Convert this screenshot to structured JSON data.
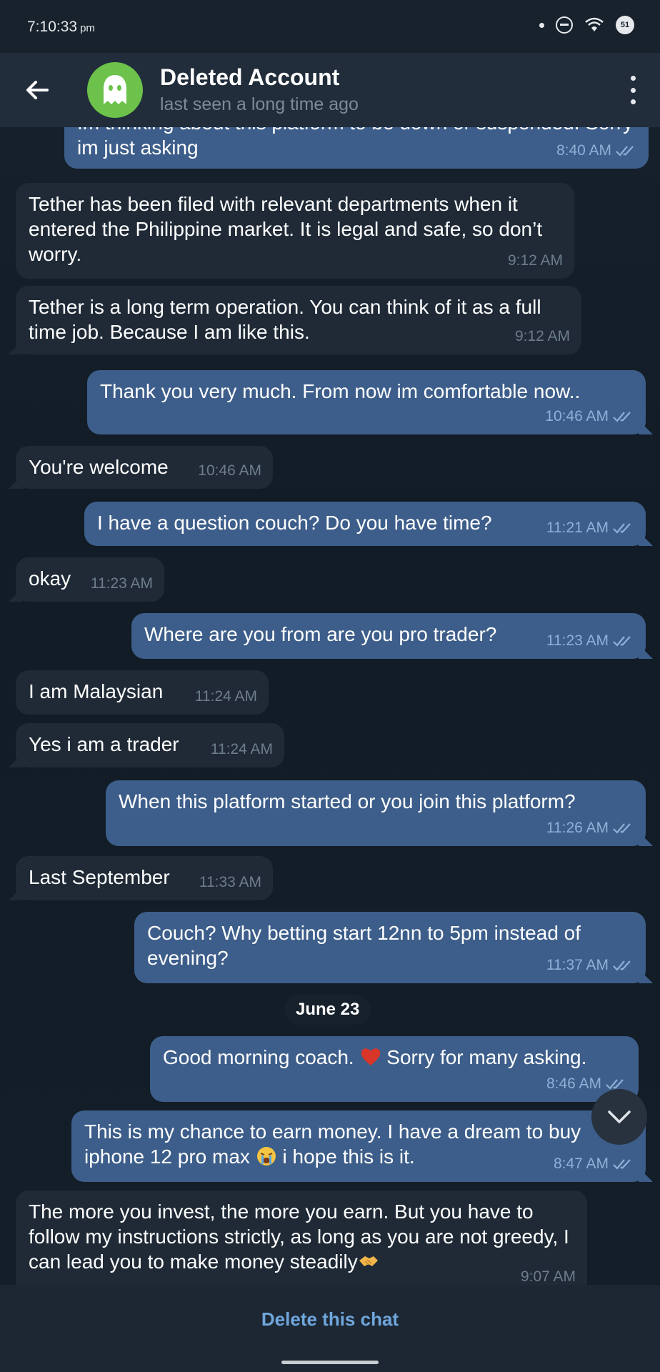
{
  "status_bar": {
    "time": "7:10:33",
    "ampm": "pm",
    "battery": "51"
  },
  "header": {
    "title": "Deleted Account",
    "subtitle": "last seen a long time ago"
  },
  "messages": [
    {
      "dir": "out",
      "text": "Im thinking about this platform to be down or suspended. Sorry im just asking",
      "time": "8:40 AM"
    },
    {
      "dir": "in",
      "text": "Tether has been filed with relevant departments when it entered the Philippine market. It is legal and safe, so don’t worry.",
      "time": "9:12 AM"
    },
    {
      "dir": "in",
      "text": "Tether is a long term operation. You can think of it as a full time job. Because I am like this.",
      "time": "9:12 AM"
    },
    {
      "dir": "out",
      "text": "Thank you very much. From now im comfortable now..",
      "time": "10:46 AM"
    },
    {
      "dir": "in",
      "text": "You're welcome",
      "time": "10:46 AM"
    },
    {
      "dir": "out",
      "text": "I have a question couch? Do you have time?",
      "time": "11:21 AM"
    },
    {
      "dir": "in",
      "text": "okay",
      "time": "11:23 AM"
    },
    {
      "dir": "out",
      "text": "Where are you from are you pro trader?",
      "time": "11:23 AM"
    },
    {
      "dir": "in",
      "text": "I am Malaysian",
      "time": "11:24 AM"
    },
    {
      "dir": "in",
      "text": "Yes i am a trader",
      "time": "11:24 AM"
    },
    {
      "dir": "out",
      "text": "When this platform started or you join this platform?",
      "time": "11:26 AM"
    },
    {
      "dir": "in",
      "text": "Last September",
      "time": "11:33 AM"
    },
    {
      "dir": "out",
      "text": "Couch? Why betting start 12nn to 5pm instead of evening?",
      "time": "11:37 AM"
    },
    {
      "dir": "out",
      "text_before": "Good morning coach.",
      "emoji": "red-heart",
      "text_after": "Sorry for many asking.",
      "time": "8:46 AM"
    },
    {
      "dir": "out",
      "text_before": "This is my chance to earn money. I have a dream to buy iphone 12 pro max",
      "emoji": "loudly-crying-face",
      "text_after": "i hope this is it.",
      "time": "8:47 AM"
    },
    {
      "dir": "in",
      "text_before": "The more you invest, the more you earn. But you have to follow my instructions strictly, as long as you are not greedy, I can lead you to make money steadily",
      "emoji": "handshake",
      "time": "9:07 AM"
    }
  ],
  "date_separator": "June 23",
  "bottom": {
    "delete_label": "Delete this chat"
  },
  "colors": {
    "incoming": "#1f2a36",
    "outgoing": "#3d5e8a",
    "accent": "#6fa6dc",
    "avatar": "#6cc24a"
  }
}
